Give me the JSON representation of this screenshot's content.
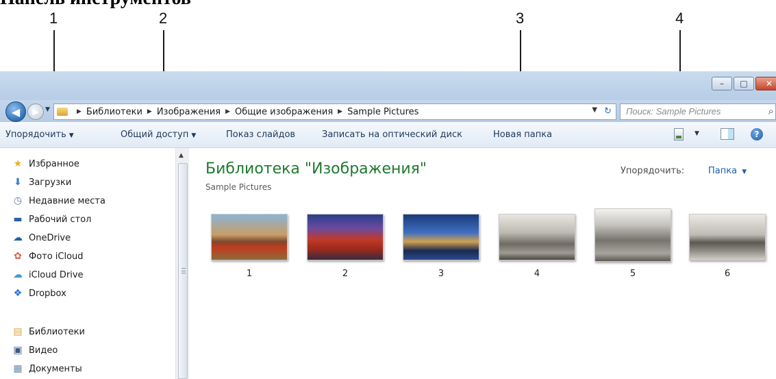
{
  "annotations": {
    "heading": "Панель инструментов",
    "callouts": [
      "1",
      "2",
      "3",
      "4"
    ]
  },
  "window": {
    "controls": {
      "minimize": "–",
      "maximize": "□",
      "close": "✕"
    }
  },
  "addressbar": {
    "breadcrumbs": [
      "Библиотеки",
      "Изображения",
      "Общие изображения",
      "Sample Pictures"
    ],
    "search_placeholder": "Поиск: Sample Pictures"
  },
  "toolbar": {
    "organize": "Упорядочить",
    "share": "Общий доступ",
    "slideshow": "Показ слайдов",
    "burn": "Записать на оптический диск",
    "new_folder": "Новая папка"
  },
  "navpane": {
    "favorites": [
      {
        "label": "Избранное",
        "icon": "star-icon"
      },
      {
        "label": "Загрузки",
        "icon": "downloads-icon"
      },
      {
        "label": "Недавние места",
        "icon": "recent-places-icon"
      },
      {
        "label": "Рабочий стол",
        "icon": "desktop-icon"
      },
      {
        "label": "OneDrive",
        "icon": "onedrive-icon"
      },
      {
        "label": "Фото iCloud",
        "icon": "icloud-photos-icon"
      },
      {
        "label": "iCloud Drive",
        "icon": "icloud-drive-icon"
      },
      {
        "label": "Dropbox",
        "icon": "dropbox-icon"
      }
    ],
    "libraries": [
      {
        "label": "Библиотеки",
        "icon": "libraries-icon"
      },
      {
        "label": "Видео",
        "icon": "video-icon"
      },
      {
        "label": "Документы",
        "icon": "documents-icon"
      }
    ]
  },
  "content": {
    "title": "Библиотека \"Изображения\"",
    "subtitle": "Sample Pictures",
    "arrange_label": "Упорядочить:",
    "arrange_value": "Папка",
    "items": [
      "1",
      "2",
      "3",
      "4",
      "5",
      "6"
    ]
  },
  "colors": {
    "title_green": "#1f7a2f",
    "link_blue": "#1f5fb0",
    "toolbar_text": "#1e395b"
  }
}
